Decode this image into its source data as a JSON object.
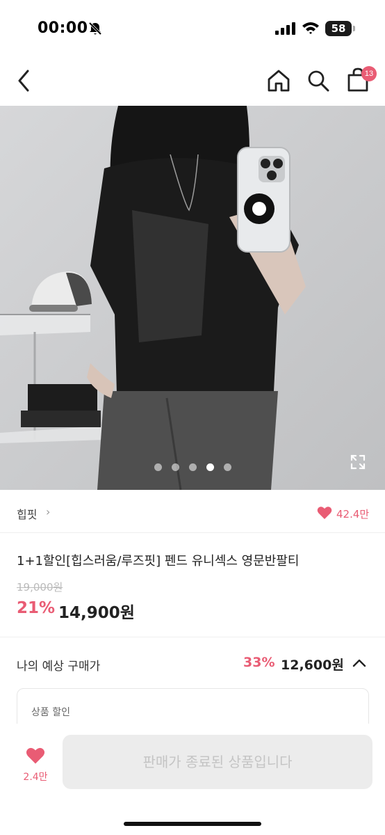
{
  "status_bar": {
    "time": "00:00",
    "battery": "58"
  },
  "nav": {
    "back_icon": "chevron-left-icon",
    "home_icon": "home-icon",
    "search_icon": "search-icon",
    "cart_icon": "shopping-bag-icon",
    "cart_count": "13"
  },
  "gallery": {
    "total_images": 5,
    "current_index": 3
  },
  "brand": {
    "name": "힙핏",
    "chevron": "›",
    "like_count": "42.4만"
  },
  "product": {
    "title": "1+1할인[힙스러움/루즈핏] 펜드 유니섹스 영문반팔티",
    "original_price": "19,000원",
    "discount_rate": "21%",
    "sale_price": "14,900원"
  },
  "expected_price": {
    "label": "나의 예상 구매가",
    "discount_rate": "33%",
    "price": "12,600원"
  },
  "discount_box": {
    "label": "상품 할인"
  },
  "bottom_bar": {
    "wish_count": "2.4만",
    "buy_button_label": "판매가 종료된 상품입니다"
  },
  "colors": {
    "accent": "#e95c74",
    "disabled_button": "#ececec"
  }
}
